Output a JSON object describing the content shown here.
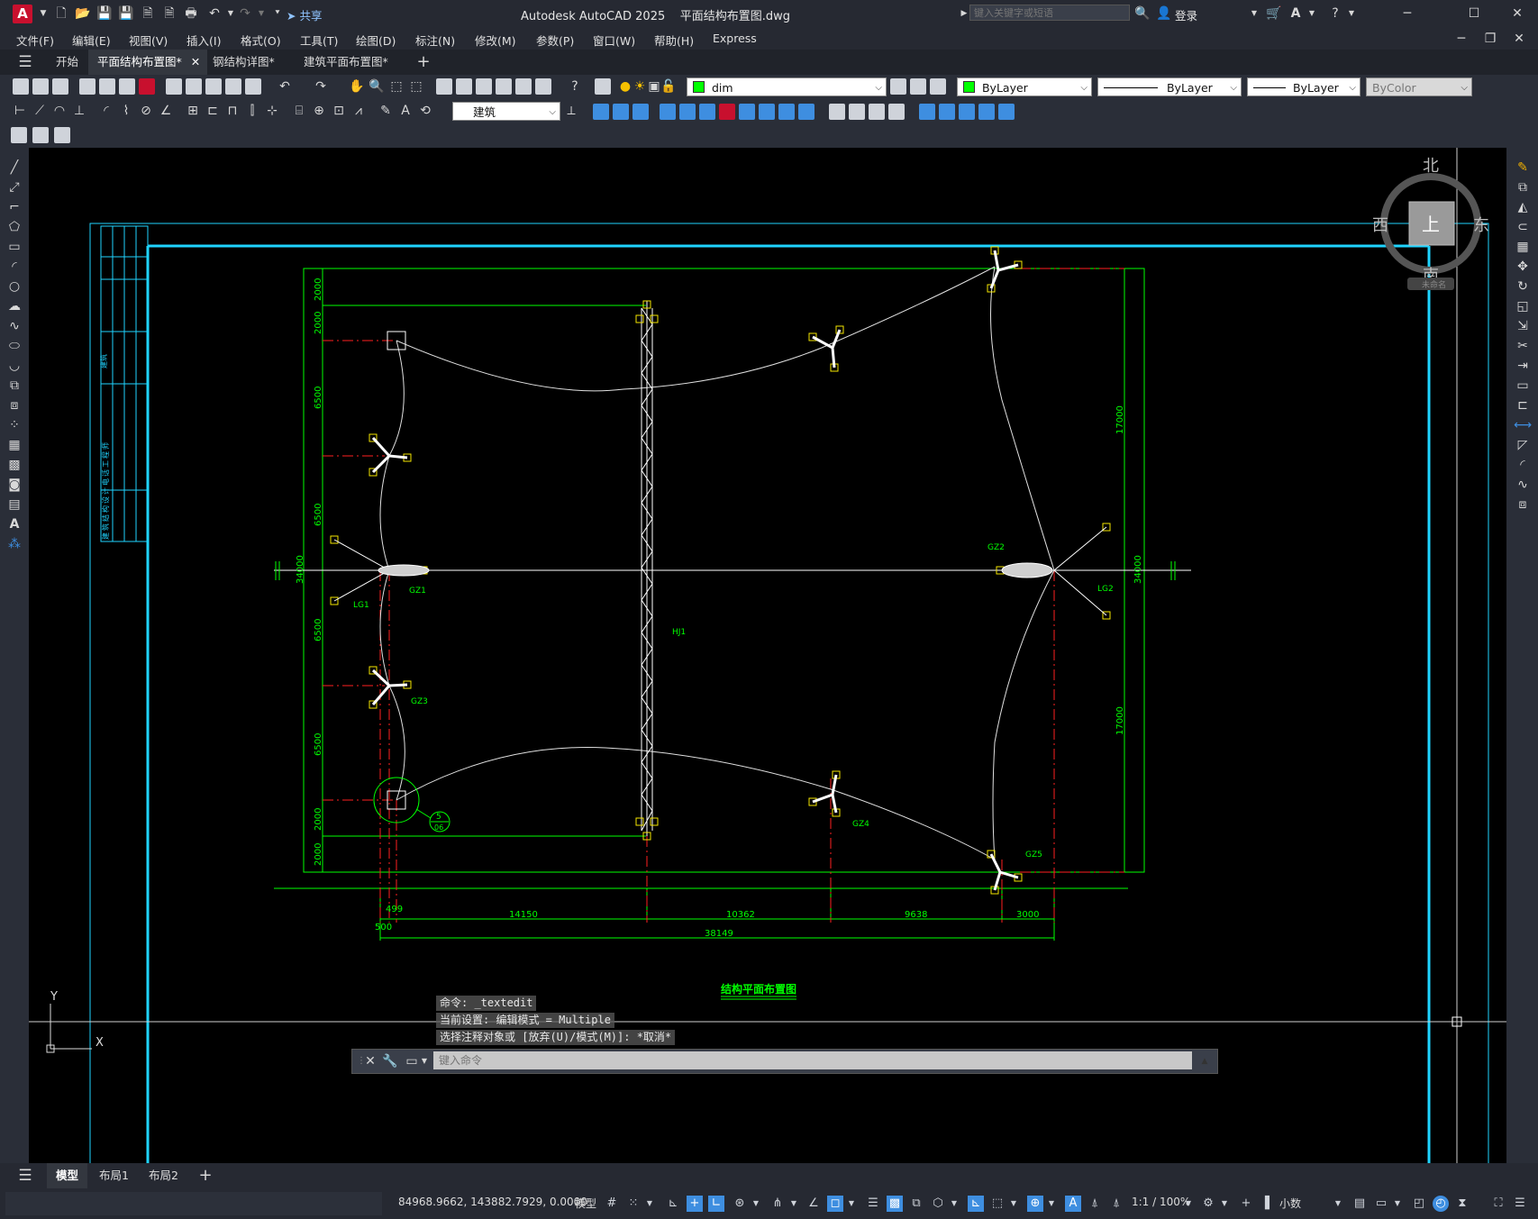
{
  "app": {
    "title": "Autodesk AutoCAD 2025",
    "file": "平面结构布置图.dwg",
    "share": "共享",
    "search_placeholder": "键入关键字或短语",
    "login": "登录"
  },
  "menu": [
    "文件(F)",
    "编辑(E)",
    "视图(V)",
    "插入(I)",
    "格式(O)",
    "工具(T)",
    "绘图(D)",
    "标注(N)",
    "修改(M)",
    "参数(P)",
    "窗口(W)",
    "帮助(H)",
    "Express"
  ],
  "doc_tabs": [
    {
      "label": "开始",
      "active": false
    },
    {
      "label": "平面结构布置图*",
      "active": true
    },
    {
      "label": "钢结构详图*",
      "active": false
    },
    {
      "label": "建筑平面布置图*",
      "active": false
    }
  ],
  "toolbar": {
    "layer": "dim",
    "color": "ByLayer",
    "linetype": "ByLayer",
    "lineweight": "ByLayer",
    "plotstyle": "ByColor",
    "textstyle": "建筑"
  },
  "viewcube": {
    "north": "北",
    "south": "南",
    "east": "东",
    "west": "西",
    "top": "上",
    "wcs": "未命名"
  },
  "ucs": {
    "y": "Y",
    "x": "X"
  },
  "drawing": {
    "title": "结构平面布置图",
    "left_dims": [
      "2000",
      "2000",
      "6500",
      "6500",
      "6500",
      "6500",
      "2000",
      "2000"
    ],
    "left_total": "34000",
    "right_dims": [
      "17000",
      "17000"
    ],
    "right_total": "34000",
    "bottom_dims": [
      "499",
      "500",
      "14150",
      "10362",
      "9638",
      "3000"
    ],
    "bottom_total": "38149",
    "labels": {
      "gz1": "GZ1",
      "gz2": "GZ2",
      "gz3": "GZ3",
      "gz4": "GZ4",
      "gz5": "GZ5",
      "lg1": "LG1",
      "lg2": "LG2",
      "hj1": "HJ1"
    },
    "detail_num": "5",
    "detail_sheet": "06",
    "titleblock_texts": [
      "建筑",
      "建筑结构设计电话工程师",
      "",
      "",
      ""
    ]
  },
  "command": {
    "history": [
      "命令: _textedit",
      "当前设置: 编辑模式 = Multiple",
      "选择注释对象或 [放弃(U)/模式(M)]: *取消*"
    ],
    "placeholder": "键入命令"
  },
  "layout_tabs": [
    "模型",
    "布局1",
    "布局2"
  ],
  "status": {
    "coords": "84968.9662, 143882.7929, 0.0000",
    "model": "模型",
    "scale": "1:1 / 100%",
    "units": "小数"
  }
}
